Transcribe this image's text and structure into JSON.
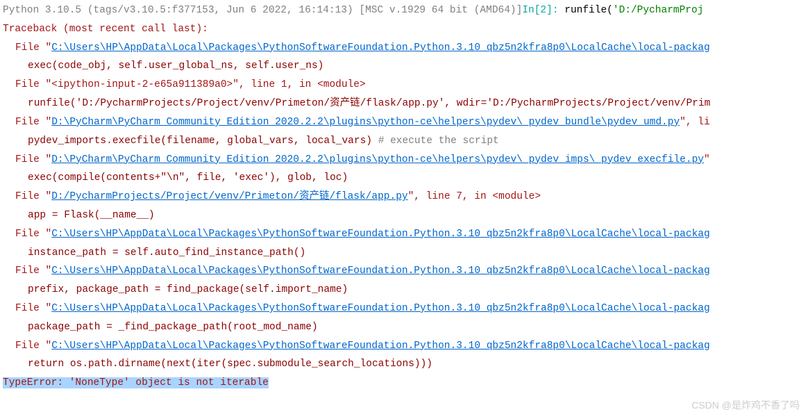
{
  "header": {
    "python_version": "Python 3.10.5 (tags/v3.10.5:f377153, Jun  6 2022, 16:14:13) [MSC v.1929 64 bit (AMD64)]",
    "prompt": "In[2]:",
    "command_pre": " runfile(",
    "command_str": "'D:/PycharmProj"
  },
  "traceback_header": "Traceback (most recent call last):",
  "frames": [
    {
      "file_prefix": "File ",
      "quote": "\"",
      "path": "C:\\Users\\HP\\AppData\\Local\\Packages\\PythonSoftwareFoundation.Python.3.10_qbz5n2kfra8p0\\LocalCache\\local-packag",
      "code": "exec(code_obj, self.user_global_ns, self.user_ns)"
    },
    {
      "file_prefix": "File ",
      "raw_location": "\"<ipython-input-2-e65a911389a0>\", line 1, in <module>",
      "code_pre": "runfile(",
      "code_str": "'D:/PycharmProjects/Project/venv/Primeton/资产链/flask/app.py'",
      "code_mid": ", wdir=",
      "code_str2": "'D:/PycharmProjects/Project/venv/Prim"
    },
    {
      "file_prefix": "File ",
      "quote": "\"",
      "path": "D:\\PyCharm\\PyCharm Community Edition 2020.2.2\\plugins\\python-ce\\helpers\\pydev\\_pydev_bundle\\pydev_umd.py",
      "suffix": "\", li",
      "code": "pydev_imports.execfile(filename, global_vars, local_vars)  ",
      "comment": "# execute the script"
    },
    {
      "file_prefix": "File ",
      "quote": "\"",
      "path": "D:\\PyCharm\\PyCharm Community Edition 2020.2.2\\plugins\\python-ce\\helpers\\pydev\\_pydev_imps\\_pydev_execfile.py",
      "suffix": "\"",
      "code": "exec(compile(contents+\"\\n\", file, 'exec'), glob, loc)"
    },
    {
      "file_prefix": "File ",
      "quote": "\"",
      "path": "D:/PycharmProjects/Project/venv/Primeton/资产链/flask/app.py",
      "suffix": "\", line 7, in <module>",
      "code": "app = Flask(__name__)"
    },
    {
      "file_prefix": "File ",
      "quote": "\"",
      "path": "C:\\Users\\HP\\AppData\\Local\\Packages\\PythonSoftwareFoundation.Python.3.10_qbz5n2kfra8p0\\LocalCache\\local-packag",
      "code": "instance_path = self.auto_find_instance_path()"
    },
    {
      "file_prefix": "File ",
      "quote": "\"",
      "path": "C:\\Users\\HP\\AppData\\Local\\Packages\\PythonSoftwareFoundation.Python.3.10_qbz5n2kfra8p0\\LocalCache\\local-packag",
      "code": "prefix, package_path = find_package(self.import_name)"
    },
    {
      "file_prefix": "File ",
      "quote": "\"",
      "path": "C:\\Users\\HP\\AppData\\Local\\Packages\\PythonSoftwareFoundation.Python.3.10_qbz5n2kfra8p0\\LocalCache\\local-packag",
      "code": "package_path = _find_package_path(root_mod_name)"
    },
    {
      "file_prefix": "File ",
      "quote": "\"",
      "path": "C:\\Users\\HP\\AppData\\Local\\Packages\\PythonSoftwareFoundation.Python.3.10_qbz5n2kfra8p0\\LocalCache\\local-packag",
      "code": "return os.path.dirname(next(iter(spec.submodule_search_locations)))"
    }
  ],
  "error": "TypeError: 'NoneType' object is not iterable",
  "watermark": "CSDN @是炸鸡不香了吗"
}
